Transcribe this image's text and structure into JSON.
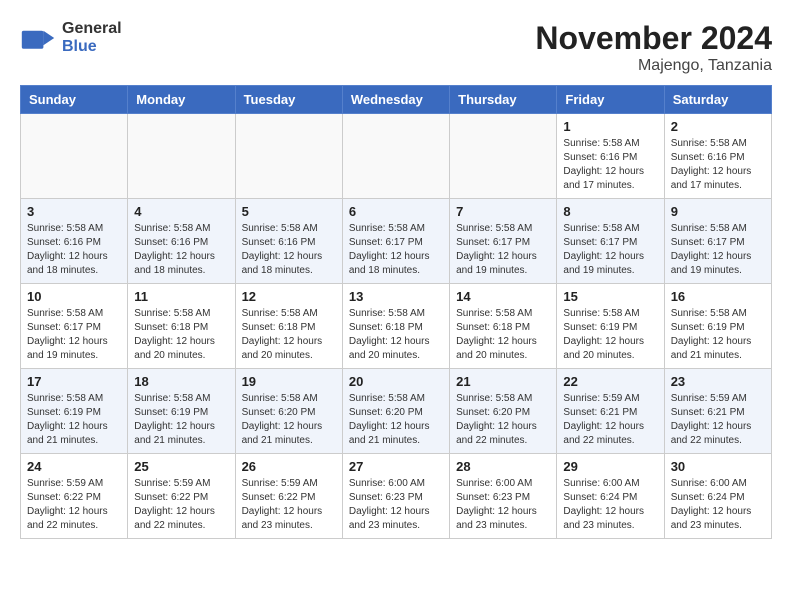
{
  "logo": {
    "general": "General",
    "blue": "Blue"
  },
  "title": "November 2024",
  "location": "Majengo, Tanzania",
  "days_of_week": [
    "Sunday",
    "Monday",
    "Tuesday",
    "Wednesday",
    "Thursday",
    "Friday",
    "Saturday"
  ],
  "weeks": [
    [
      {
        "day": "",
        "info": ""
      },
      {
        "day": "",
        "info": ""
      },
      {
        "day": "",
        "info": ""
      },
      {
        "day": "",
        "info": ""
      },
      {
        "day": "",
        "info": ""
      },
      {
        "day": "1",
        "info": "Sunrise: 5:58 AM\nSunset: 6:16 PM\nDaylight: 12 hours and 17 minutes."
      },
      {
        "day": "2",
        "info": "Sunrise: 5:58 AM\nSunset: 6:16 PM\nDaylight: 12 hours and 17 minutes."
      }
    ],
    [
      {
        "day": "3",
        "info": "Sunrise: 5:58 AM\nSunset: 6:16 PM\nDaylight: 12 hours and 18 minutes."
      },
      {
        "day": "4",
        "info": "Sunrise: 5:58 AM\nSunset: 6:16 PM\nDaylight: 12 hours and 18 minutes."
      },
      {
        "day": "5",
        "info": "Sunrise: 5:58 AM\nSunset: 6:16 PM\nDaylight: 12 hours and 18 minutes."
      },
      {
        "day": "6",
        "info": "Sunrise: 5:58 AM\nSunset: 6:17 PM\nDaylight: 12 hours and 18 minutes."
      },
      {
        "day": "7",
        "info": "Sunrise: 5:58 AM\nSunset: 6:17 PM\nDaylight: 12 hours and 19 minutes."
      },
      {
        "day": "8",
        "info": "Sunrise: 5:58 AM\nSunset: 6:17 PM\nDaylight: 12 hours and 19 minutes."
      },
      {
        "day": "9",
        "info": "Sunrise: 5:58 AM\nSunset: 6:17 PM\nDaylight: 12 hours and 19 minutes."
      }
    ],
    [
      {
        "day": "10",
        "info": "Sunrise: 5:58 AM\nSunset: 6:17 PM\nDaylight: 12 hours and 19 minutes."
      },
      {
        "day": "11",
        "info": "Sunrise: 5:58 AM\nSunset: 6:18 PM\nDaylight: 12 hours and 20 minutes."
      },
      {
        "day": "12",
        "info": "Sunrise: 5:58 AM\nSunset: 6:18 PM\nDaylight: 12 hours and 20 minutes."
      },
      {
        "day": "13",
        "info": "Sunrise: 5:58 AM\nSunset: 6:18 PM\nDaylight: 12 hours and 20 minutes."
      },
      {
        "day": "14",
        "info": "Sunrise: 5:58 AM\nSunset: 6:18 PM\nDaylight: 12 hours and 20 minutes."
      },
      {
        "day": "15",
        "info": "Sunrise: 5:58 AM\nSunset: 6:19 PM\nDaylight: 12 hours and 20 minutes."
      },
      {
        "day": "16",
        "info": "Sunrise: 5:58 AM\nSunset: 6:19 PM\nDaylight: 12 hours and 21 minutes."
      }
    ],
    [
      {
        "day": "17",
        "info": "Sunrise: 5:58 AM\nSunset: 6:19 PM\nDaylight: 12 hours and 21 minutes."
      },
      {
        "day": "18",
        "info": "Sunrise: 5:58 AM\nSunset: 6:19 PM\nDaylight: 12 hours and 21 minutes."
      },
      {
        "day": "19",
        "info": "Sunrise: 5:58 AM\nSunset: 6:20 PM\nDaylight: 12 hours and 21 minutes."
      },
      {
        "day": "20",
        "info": "Sunrise: 5:58 AM\nSunset: 6:20 PM\nDaylight: 12 hours and 21 minutes."
      },
      {
        "day": "21",
        "info": "Sunrise: 5:58 AM\nSunset: 6:20 PM\nDaylight: 12 hours and 22 minutes."
      },
      {
        "day": "22",
        "info": "Sunrise: 5:59 AM\nSunset: 6:21 PM\nDaylight: 12 hours and 22 minutes."
      },
      {
        "day": "23",
        "info": "Sunrise: 5:59 AM\nSunset: 6:21 PM\nDaylight: 12 hours and 22 minutes."
      }
    ],
    [
      {
        "day": "24",
        "info": "Sunrise: 5:59 AM\nSunset: 6:22 PM\nDaylight: 12 hours and 22 minutes."
      },
      {
        "day": "25",
        "info": "Sunrise: 5:59 AM\nSunset: 6:22 PM\nDaylight: 12 hours and 22 minutes."
      },
      {
        "day": "26",
        "info": "Sunrise: 5:59 AM\nSunset: 6:22 PM\nDaylight: 12 hours and 23 minutes."
      },
      {
        "day": "27",
        "info": "Sunrise: 6:00 AM\nSunset: 6:23 PM\nDaylight: 12 hours and 23 minutes."
      },
      {
        "day": "28",
        "info": "Sunrise: 6:00 AM\nSunset: 6:23 PM\nDaylight: 12 hours and 23 minutes."
      },
      {
        "day": "29",
        "info": "Sunrise: 6:00 AM\nSunset: 6:24 PM\nDaylight: 12 hours and 23 minutes."
      },
      {
        "day": "30",
        "info": "Sunrise: 6:00 AM\nSunset: 6:24 PM\nDaylight: 12 hours and 23 minutes."
      }
    ]
  ]
}
